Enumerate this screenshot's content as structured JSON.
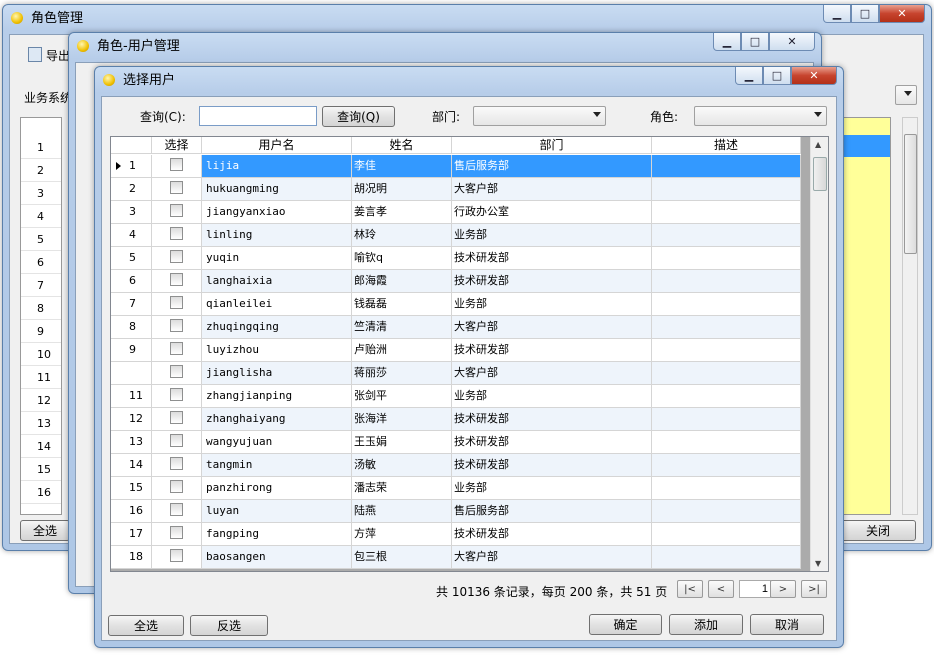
{
  "back_window": {
    "title": "角色管理",
    "toolbar_export": "导出",
    "business_label": "业务系统",
    "row_numbers": [
      "1",
      "2",
      "3",
      "4",
      "5",
      "6",
      "7",
      "8",
      "9",
      "10",
      "11",
      "12",
      "13",
      "14",
      "15",
      "16"
    ],
    "select_all": "全选",
    "close": "关闭"
  },
  "mid_window": {
    "title": "角色-用户管理"
  },
  "dialog": {
    "title": "选择用户",
    "query_label": "查询(C):",
    "query_value": "",
    "query_button": "查询(Q)",
    "dept_label": "部门:",
    "dept_value": "",
    "role_label": "角色:",
    "role_value": "",
    "columns": [
      "选择",
      "用户名",
      "姓名",
      "部门",
      "描述"
    ],
    "rows": [
      {
        "idx": "1",
        "user": "lijia",
        "name": "李佳",
        "dept": "售后服务部",
        "desc": ""
      },
      {
        "idx": "2",
        "user": "hukuangming",
        "name": "胡况明",
        "dept": "大客户部",
        "desc": ""
      },
      {
        "idx": "3",
        "user": "jiangyanxiao",
        "name": "姜言孝",
        "dept": "行政办公室",
        "desc": ""
      },
      {
        "idx": "4",
        "user": "linling",
        "name": "林玲",
        "dept": "业务部",
        "desc": ""
      },
      {
        "idx": "5",
        "user": "yuqin",
        "name": "喻钦q",
        "dept": "技术研发部",
        "desc": ""
      },
      {
        "idx": "6",
        "user": "langhaixia",
        "name": "郎海霞",
        "dept": "技术研发部",
        "desc": ""
      },
      {
        "idx": "7",
        "user": "qianleilei",
        "name": "钱磊磊",
        "dept": "业务部",
        "desc": ""
      },
      {
        "idx": "8",
        "user": "zhuqingqing",
        "name": "竺清清",
        "dept": "大客户部",
        "desc": ""
      },
      {
        "idx": "9",
        "user": "luyizhou",
        "name": "卢贻洲",
        "dept": "技术研发部",
        "desc": ""
      },
      {
        "idx": "",
        "user": "jianglisha",
        "name": "蒋丽莎",
        "dept": "大客户部",
        "desc": ""
      },
      {
        "idx": "11",
        "user": "zhangjianping",
        "name": "张剑平",
        "dept": "业务部",
        "desc": ""
      },
      {
        "idx": "12",
        "user": "zhanghaiyang",
        "name": "张海洋",
        "dept": "技术研发部",
        "desc": ""
      },
      {
        "idx": "13",
        "user": "wangyujuan",
        "name": "王玉娟",
        "dept": "技术研发部",
        "desc": ""
      },
      {
        "idx": "14",
        "user": "tangmin",
        "name": "汤敏",
        "dept": "技术研发部",
        "desc": ""
      },
      {
        "idx": "15",
        "user": "panzhirong",
        "name": "潘志荣",
        "dept": "业务部",
        "desc": ""
      },
      {
        "idx": "16",
        "user": "luyan",
        "name": "陆燕",
        "dept": "售后服务部",
        "desc": ""
      },
      {
        "idx": "17",
        "user": "fangping",
        "name": "方萍",
        "dept": "技术研发部",
        "desc": ""
      },
      {
        "idx": "18",
        "user": "baosangen",
        "name": "包三根",
        "dept": "大客户部",
        "desc": ""
      }
    ],
    "pager_text": "共 10136 条记录，每页 200 条，共 51 页",
    "page_number": "1",
    "select_all": "全选",
    "invert": "反选",
    "ok": "确定",
    "add": "添加",
    "cancel": "取消"
  },
  "colors": {
    "selected_row": "#3399ff",
    "alt_row": "#eef4fb",
    "yellow_cells": "#ffff99"
  }
}
